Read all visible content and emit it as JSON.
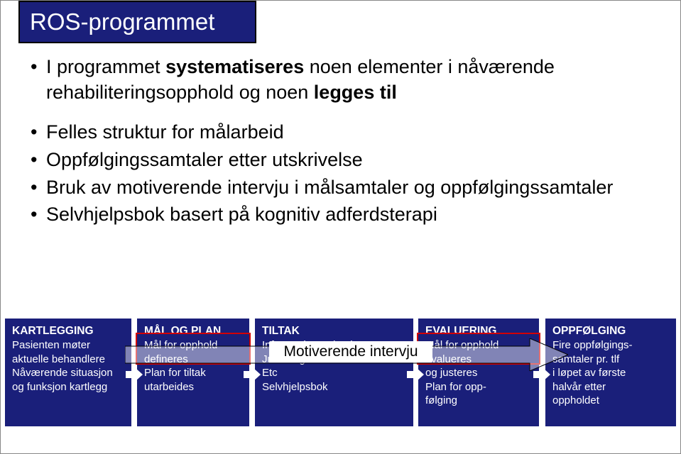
{
  "title": "ROS-programmet",
  "bullets": [
    {
      "pre": "I programmet ",
      "bold1": "systematiseres",
      "mid": " noen elementer i nåværende rehabiliteringsopphold og noen ",
      "bold2": "legges til",
      "post": ""
    },
    {
      "pre": "Felles struktur for målarbeid",
      "bold1": "",
      "mid": "",
      "bold2": "",
      "post": ""
    },
    {
      "pre": "Oppfølgingssamtaler etter utskrivelse",
      "bold1": "",
      "mid": "",
      "bold2": "",
      "post": ""
    },
    {
      "pre": "Bruk av motiverende intervju i målsamtaler og oppfølgingssamtaler",
      "bold1": "",
      "mid": "",
      "bold2": "",
      "post": ""
    },
    {
      "pre": "Selvhjelpsbok basert på kognitiv adferdsterapi",
      "bold1": "",
      "mid": "",
      "bold2": "",
      "post": ""
    }
  ],
  "flow": {
    "cols": [
      {
        "hd": "KARTLEGGING",
        "l1": "Pasienten møter",
        "l2": "aktuelle behandlere",
        "l3": "Nåværende situasjon",
        "l4": "og funksjon kartlegg"
      },
      {
        "hd": "MÅL OG PLAN",
        "l1": "Mål for opphold",
        "l2": "defineres",
        "l3": "Plan for tiltak",
        "l4": "utarbeides"
      },
      {
        "hd": "TILTAK",
        "l1": "Informasjonundervisn",
        "l2": "Justering av medikam",
        "l3": "Etc",
        "l4": "Selvhjelpsbok"
      },
      {
        "hd": "EVALUERING",
        "l1": "Mål for opphold",
        "l2": "evalueres",
        "l3": "og justeres",
        "l4": "Plan for opp-",
        "l5": "følging"
      },
      {
        "hd": "OPPFØLGING",
        "l1": "Fire oppfølgings-",
        "l2": "samtaler pr. tlf",
        "l3": "i løpet av første",
        "l4": "halvår etter",
        "l5": "oppholdet"
      }
    ],
    "arrow_label": "Motiverende intervju"
  }
}
